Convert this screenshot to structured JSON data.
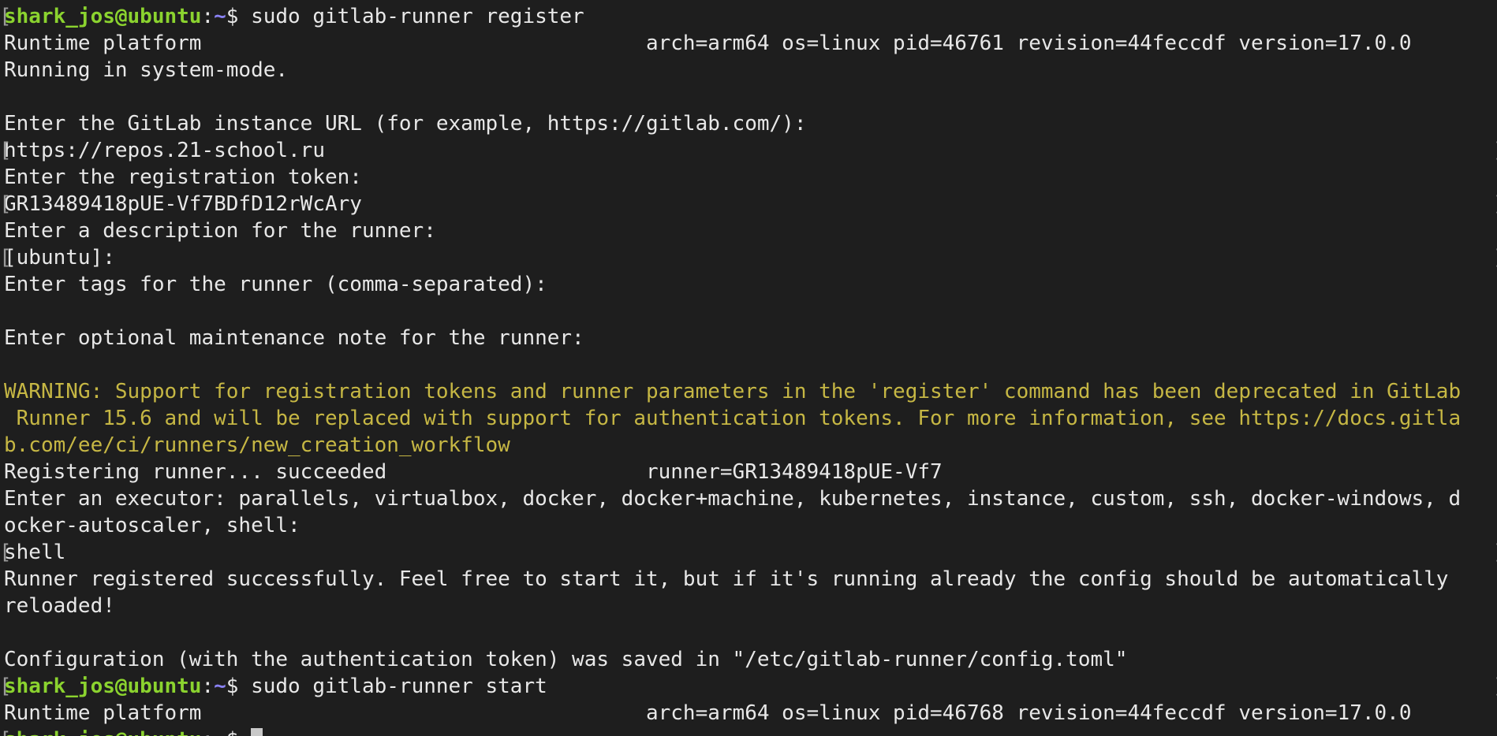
{
  "terminal": {
    "lines": [
      {
        "segments": [
          {
            "text": "shark_jos@ubuntu",
            "color": "green"
          },
          {
            "text": ":",
            "color": "default"
          },
          {
            "text": "~",
            "color": "blue"
          },
          {
            "text": "$ sudo gitlab-runner register",
            "color": "default"
          }
        ],
        "left_mark": true,
        "right_mark": false
      },
      {
        "segments": [
          {
            "text": "Runtime platform                                    arch=arm64 os=linux pid=46761 revision=44feccdf version=17.0.0",
            "color": "default"
          }
        ],
        "left_mark": false,
        "right_mark": false
      },
      {
        "segments": [
          {
            "text": "Running in system-mode.",
            "color": "default"
          }
        ],
        "left_mark": false,
        "right_mark": false
      },
      {
        "segments": [
          {
            "text": "",
            "color": "default"
          }
        ],
        "left_mark": false,
        "right_mark": false
      },
      {
        "segments": [
          {
            "text": "Enter the GitLab instance URL (for example, https://gitlab.com/):",
            "color": "default"
          }
        ],
        "left_mark": false,
        "right_mark": false
      },
      {
        "segments": [
          {
            "text": "https://repos.21-school.ru",
            "color": "default"
          }
        ],
        "left_mark": true,
        "right_mark": true
      },
      {
        "segments": [
          {
            "text": "Enter the registration token:",
            "color": "default"
          }
        ],
        "left_mark": false,
        "right_mark": false
      },
      {
        "segments": [
          {
            "text": "GR13489418pUE-Vf7BDfD12rWcAry",
            "color": "default"
          }
        ],
        "left_mark": true,
        "right_mark": true
      },
      {
        "segments": [
          {
            "text": "Enter a description for the runner:",
            "color": "default"
          }
        ],
        "left_mark": false,
        "right_mark": false
      },
      {
        "segments": [
          {
            "text": "[ubuntu]:",
            "color": "default"
          }
        ],
        "left_mark": true,
        "right_mark": true
      },
      {
        "segments": [
          {
            "text": "Enter tags for the runner (comma-separated):",
            "color": "default"
          }
        ],
        "left_mark": false,
        "right_mark": false
      },
      {
        "segments": [
          {
            "text": "",
            "color": "default"
          }
        ],
        "left_mark": false,
        "right_mark": false
      },
      {
        "segments": [
          {
            "text": "Enter optional maintenance note for the runner:",
            "color": "default"
          }
        ],
        "left_mark": false,
        "right_mark": false
      },
      {
        "segments": [
          {
            "text": "",
            "color": "default"
          }
        ],
        "left_mark": false,
        "right_mark": false
      },
      {
        "segments": [
          {
            "text": "WARNING: Support for registration tokens and runner parameters in the 'register' command has been deprecated in GitLab",
            "color": "warn"
          }
        ],
        "left_mark": false,
        "right_mark": false
      },
      {
        "segments": [
          {
            "text": " Runner 15.6 and will be replaced with support for authentication tokens. For more information, see https://docs.gitla",
            "color": "warn"
          }
        ],
        "left_mark": false,
        "right_mark": false
      },
      {
        "segments": [
          {
            "text": "b.com/ee/ci/runners/new_creation_workflow",
            "color": "warn"
          }
        ],
        "left_mark": false,
        "right_mark": false
      },
      {
        "segments": [
          {
            "text": "Registering runner... succeeded                     runner=GR13489418pUE-Vf7",
            "color": "default"
          }
        ],
        "left_mark": false,
        "right_mark": false
      },
      {
        "segments": [
          {
            "text": "Enter an executor: parallels, virtualbox, docker, docker+machine, kubernetes, instance, custom, ssh, docker-windows, d",
            "color": "default"
          }
        ],
        "left_mark": false,
        "right_mark": false
      },
      {
        "segments": [
          {
            "text": "ocker-autoscaler, shell:",
            "color": "default"
          }
        ],
        "left_mark": false,
        "right_mark": false
      },
      {
        "segments": [
          {
            "text": "shell",
            "color": "default"
          }
        ],
        "left_mark": true,
        "right_mark": true
      },
      {
        "segments": [
          {
            "text": "Runner registered successfully. Feel free to start it, but if it's running already the config should be automatically",
            "color": "default"
          }
        ],
        "left_mark": false,
        "right_mark": false
      },
      {
        "segments": [
          {
            "text": "reloaded!",
            "color": "default"
          }
        ],
        "left_mark": false,
        "right_mark": false
      },
      {
        "segments": [
          {
            "text": "",
            "color": "default"
          }
        ],
        "left_mark": false,
        "right_mark": false
      },
      {
        "segments": [
          {
            "text": "Configuration (with the authentication token) was saved in \"/etc/gitlab-runner/config.toml\"",
            "color": "default"
          }
        ],
        "left_mark": false,
        "right_mark": false
      },
      {
        "segments": [
          {
            "text": "shark_jos@ubuntu",
            "color": "green"
          },
          {
            "text": ":",
            "color": "default"
          },
          {
            "text": "~",
            "color": "blue"
          },
          {
            "text": "$ sudo gitlab-runner start",
            "color": "default"
          }
        ],
        "left_mark": true,
        "right_mark": true
      },
      {
        "segments": [
          {
            "text": "Runtime platform                                    arch=arm64 os=linux pid=46768 revision=44feccdf version=17.0.0",
            "color": "default"
          }
        ],
        "left_mark": false,
        "right_mark": false
      },
      {
        "segments": [
          {
            "text": "shark_jos@ubuntu",
            "color": "green"
          },
          {
            "text": ":",
            "color": "default"
          },
          {
            "text": "~",
            "color": "blue"
          },
          {
            "text": "$ ",
            "color": "default"
          }
        ],
        "left_mark": true,
        "right_mark": false,
        "cursor": true
      }
    ],
    "mark_char": "[",
    "mark_char_right": "]"
  }
}
